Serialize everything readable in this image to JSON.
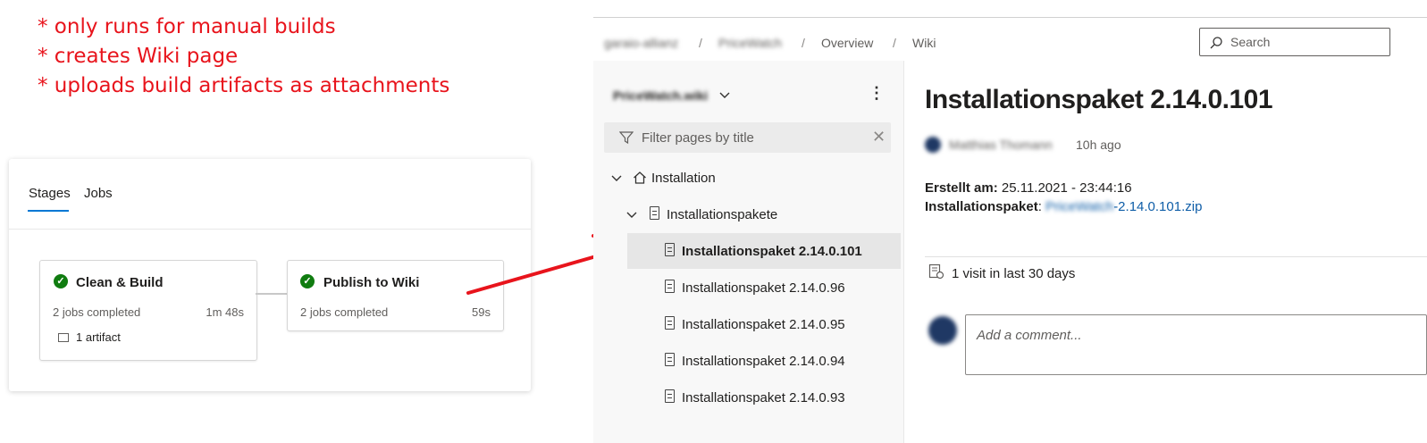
{
  "notes": [
    "* only runs for manual builds",
    "* creates Wiki page",
    "* uploads build artifacts as attachments"
  ],
  "pipeline": {
    "tabs": [
      "Stages",
      "Jobs"
    ],
    "stages": [
      {
        "title": "Clean & Build",
        "status": "2 jobs completed",
        "duration": "1m 48s",
        "artifact": "1 artifact"
      },
      {
        "title": "Publish to Wiki",
        "status": "2 jobs completed",
        "duration": "59s"
      }
    ]
  },
  "wiki": {
    "breadcrumb": [
      "garaio-allianz",
      "PriceWatch",
      "Overview",
      "Wiki"
    ],
    "search_placeholder": "Search",
    "wiki_name": "PriceWatch.wiki",
    "filter_placeholder": "Filter pages by title",
    "tree": {
      "root": "Installation",
      "folder": "Installationspakete",
      "pages": [
        "Installationspaket 2.14.0.101",
        "Installationspaket 2.14.0.96",
        "Installationspaket 2.14.0.95",
        "Installationspaket 2.14.0.94",
        "Installationspaket 2.14.0.93"
      ]
    },
    "page": {
      "title": "Installationspaket 2.14.0.101",
      "author": "Matthias Thomann",
      "time_ago": "10h ago",
      "created_label": "Erstellt am:",
      "created_value": "25.11.2021 - 23:44:16",
      "package_label": "Installationspaket",
      "package_sep": ":",
      "package_link_prefix": "PriceWatch",
      "package_link_suffix": "-2.14.0.101.zip",
      "visits": "1 visit in last 30 days",
      "comment_placeholder": "Add a comment..."
    }
  },
  "colors": {
    "accent": "#0078d4",
    "success": "#107c10",
    "annotation": "#e8141c",
    "link": "#0f5ea8"
  }
}
